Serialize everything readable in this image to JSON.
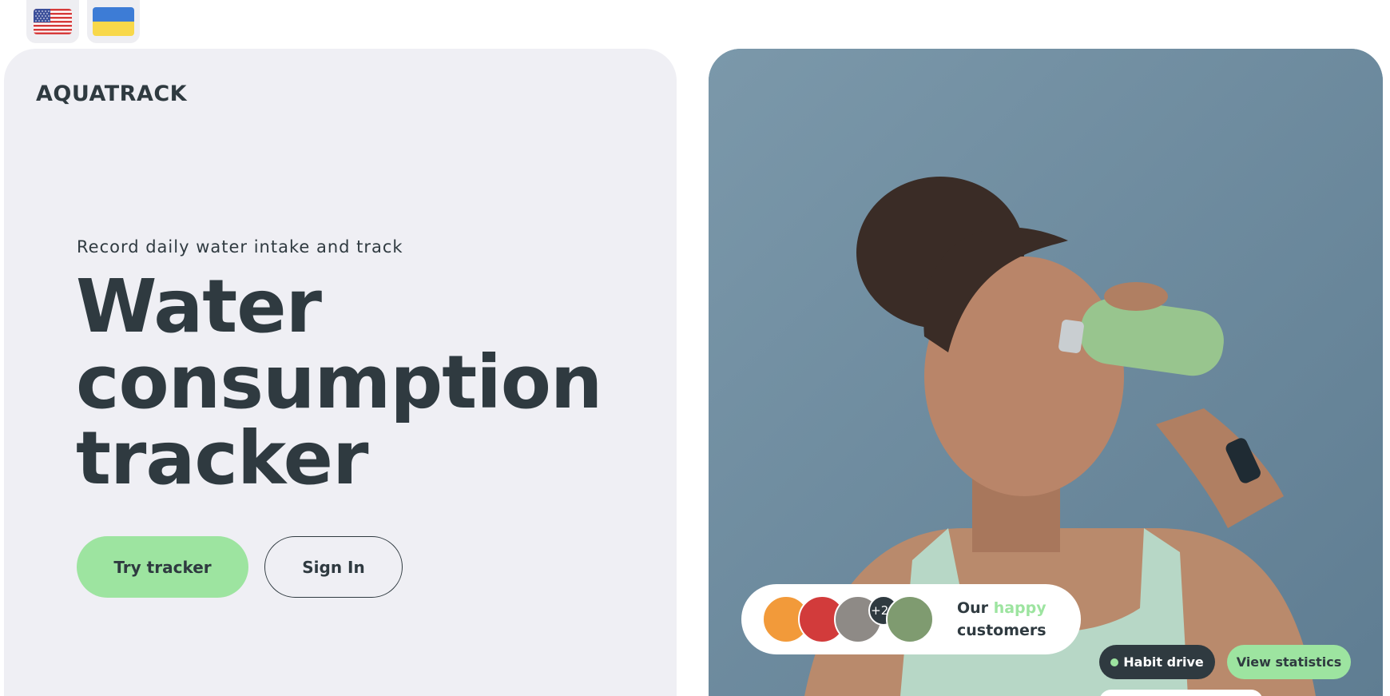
{
  "language_switcher": {
    "options": [
      {
        "name": "english-flag-icon"
      },
      {
        "name": "ukrainian-flag-icon"
      }
    ]
  },
  "brand": {
    "logo": "AQUATRACK",
    "accent_color": "#9de4a0",
    "text_color": "#2f3a40"
  },
  "hero": {
    "tagline": "Record daily water intake and track",
    "headline_lines": [
      "Water",
      "consumption",
      "tracker"
    ],
    "primary_button": "Try tracker",
    "secondary_button": "Sign In"
  },
  "customers": {
    "count_badge": "+21",
    "text_prefix": "Our",
    "text_accent": "happy",
    "text_suffix": "customers"
  },
  "badges": {
    "habit": "Habit drive",
    "stats": "View statistics"
  }
}
